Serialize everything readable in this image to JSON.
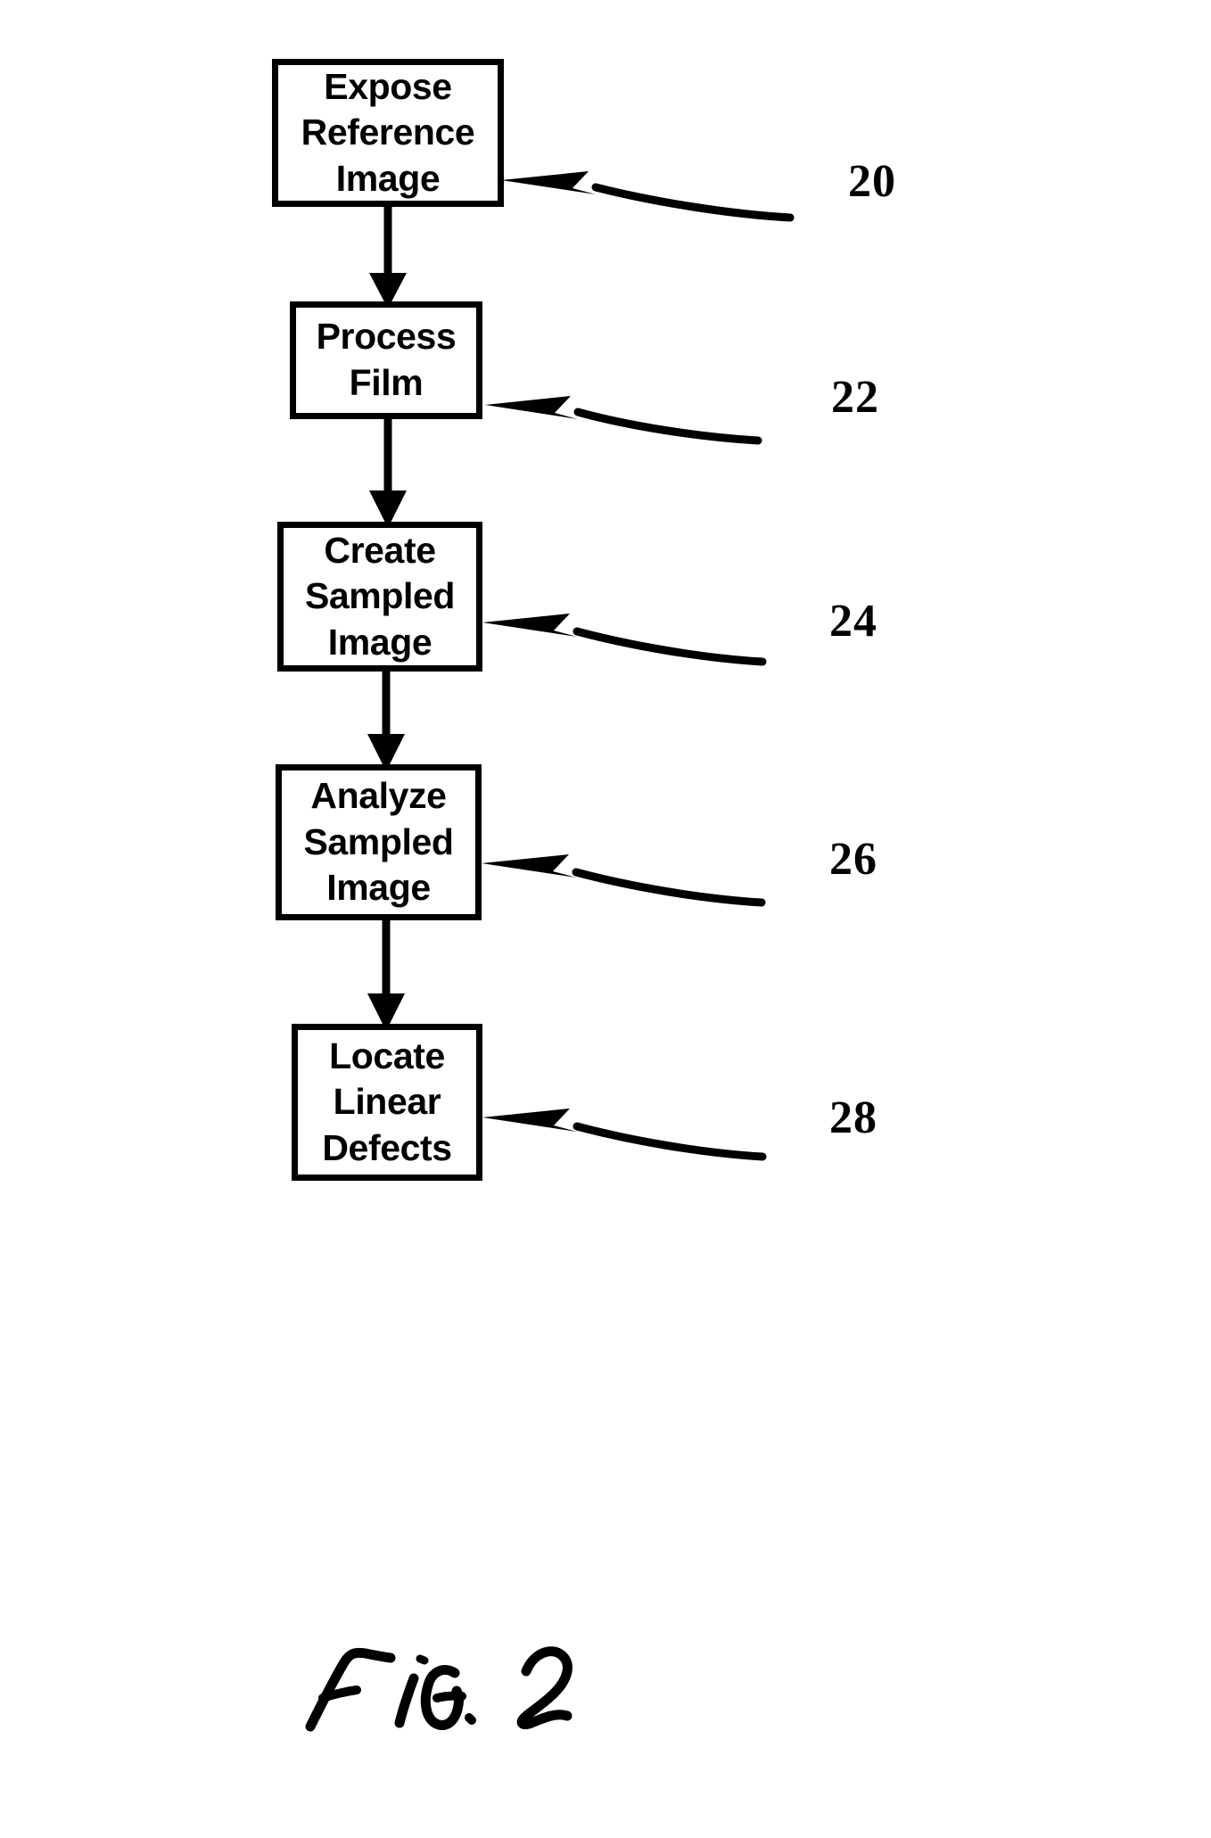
{
  "figure": {
    "caption": "FIG. 2",
    "caption_style": "handwritten",
    "type": "patent-flowchart",
    "orientation": "vertical"
  },
  "flowchart": {
    "steps": [
      {
        "id": "expose-reference-image",
        "lines": [
          "Expose",
          "Reference",
          "Image"
        ],
        "ref": "20"
      },
      {
        "id": "process-film",
        "lines": [
          "Process",
          "Film"
        ],
        "ref": "22"
      },
      {
        "id": "create-sampled-image",
        "lines": [
          "Create",
          "Sampled",
          "Image"
        ],
        "ref": "24"
      },
      {
        "id": "analyze-sampled-image",
        "lines": [
          "Analyze",
          "Sampled",
          "Image"
        ],
        "ref": "26"
      },
      {
        "id": "locate-linear-defects",
        "lines": [
          "Locate",
          "Linear",
          "Defects"
        ],
        "ref": "28"
      }
    ],
    "connector_icon": "down-arrow-icon",
    "leader_icon": "curved-leader-arrow-icon",
    "line_color": "#000000",
    "background_color": "#ffffff"
  }
}
